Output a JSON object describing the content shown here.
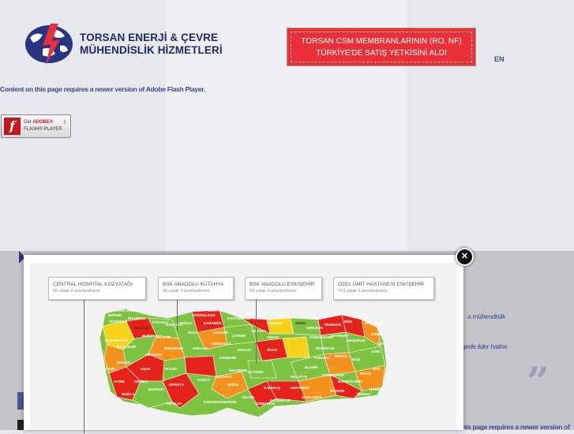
{
  "header": {
    "company_line1": "TORSAN ENERJİ & ÇEVRE",
    "company_line2": "MÜHENDİSLİK HİZMETLERİ",
    "banner_line1": "TORSAN CSM MEMBRANLARININ (RO, NF)",
    "banner_line2": "TÜRKİYE'DE SATIŞ YETKİSİNİ ALDI",
    "lang": "EN"
  },
  "flash": {
    "message": "Content on this page requires a newer version of Adobe Flash Player.",
    "btn_get": "Get",
    "btn_adobe": "ADOBE®",
    "btn_flash": "FLASH® PLAYER"
  },
  "background": {
    "snippet1": "a mühendislik",
    "snippet2": "gede lider haline",
    "quote": "„",
    "snippet3": "his page requires a newer version of"
  },
  "modal": {
    "close_icon": "close-icon",
    "hospitals": [
      {
        "name": "CENTRAL HOSPITAL KOZYATAĞI",
        "detail": "55 yatak 4 ameliyathane"
      },
      {
        "name": "BSK ANADOLU KÜTAHYA",
        "detail": "55 yatak 4 ameliyathane"
      },
      {
        "name": "BSK ANADOLU ESKİŞEHİR",
        "detail": "55 yatak 3 ameliyathane"
      },
      {
        "name": "ÖZEL ÜMİT HASTANESİ ESKİŞEHİR",
        "detail": "103 yatak 5 ameliyathane"
      }
    ],
    "map_labels": {
      "edirne": "EDİRNE",
      "kirklareli": "KIRKLARELİ",
      "tekirdag": "TEKİRDAĞ",
      "istanbul": "İSTANBUL",
      "canakkale": "ÇANAKKALE",
      "balikesir": "BALIKESİR",
      "bursa": "BURSA",
      "bilecik": "BİLECİK",
      "kocaeli": "KOCAELİ",
      "sakarya": "SAKARYA",
      "duzce": "DÜZCE",
      "bolu": "BOLU",
      "zonguldak": "ZONGULDAK",
      "bartin": "BARTIN",
      "kastamonu": "KASTAMONU",
      "sinop": "SİNOP",
      "samsun": "SAMSUN",
      "ordu": "ORDU",
      "giresun": "GİRESUN",
      "trabzon": "TRABZON",
      "rize": "RİZE",
      "artvin": "ARTVİN",
      "ardahan": "ARDAHAN",
      "kars": "KARS",
      "igdir": "IĞDIR",
      "agri": "AĞRI",
      "erzurum": "ERZURUM",
      "bayburt": "BAYBURT",
      "gumushane": "GÜMÜŞHANE",
      "erzincan": "ERZİNCAN",
      "tunceli": "TUNCELİ",
      "bingol": "BİNGÖL",
      "mus": "MUŞ",
      "van": "VAN",
      "bitlis": "BİTLİS",
      "siirt": "SİİRT",
      "batman": "BATMAN",
      "hakkari": "HAKKARİ",
      "sirnak": "ŞIRNAK",
      "mardin": "MARDİN",
      "diyarbakir": "DİYARBAKIR",
      "elazig": "ELAZIĞ",
      "malatya": "MALATYA",
      "sanliurfa": "ŞANLIURFA",
      "adiyaman": "ADIYAMAN",
      "gaziantep": "GAZİANTEP",
      "kilis": "KİLİS",
      "hatay": "HATAY",
      "osmaniye": "OSMANİYE",
      "adana": "ADANA",
      "kmaras": "K.MARAŞ",
      "mersin": "MERSİN",
      "karaman": "KARAMAN",
      "antalya": "ANTALYA",
      "konya": "KONYA",
      "nigde": "NİĞDE",
      "kayseri": "KAYSERİ",
      "nevsehir": "NEVŞEHİR",
      "aksaray": "AKSARAY",
      "kirsehir": "KIRŞEHİR",
      "yozgat": "YOZGAT",
      "sivas": "SİVAS",
      "tokat": "TOKAT",
      "amasya": "AMASYA",
      "corum": "ÇORUM",
      "cankiri": "ÇANKIRI",
      "karabuk": "KARABÜK",
      "ankara": "ANKARA",
      "kirikkale": "KIRIKKALE",
      "eskisehir": "ESKİŞEHİR",
      "kutahya": "KÜTAHYA",
      "afyon": "AFYON",
      "usak": "UŞAK",
      "manisa": "MANİSA",
      "izmir": "İZMİR",
      "aydin": "AYDIN",
      "denizli": "DENİZLİ",
      "mugla": "MUĞLA",
      "burdur": "BURDUR",
      "isparta": "ISPARTA",
      "yalova": "YALOVA"
    }
  },
  "colors": {
    "brand_blue": "#1f2a6b",
    "banner_red": "#e93038",
    "region_red": "#e5231b",
    "region_orange": "#f2921c",
    "region_green": "#7ec242",
    "region_yellow": "#f7d21b"
  }
}
